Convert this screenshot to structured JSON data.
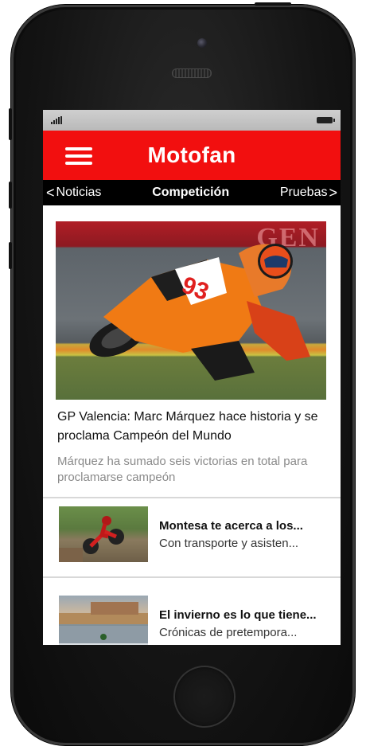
{
  "app": {
    "title": "Motofan"
  },
  "tabs": [
    {
      "label": "Noticias",
      "arrow": "<"
    },
    {
      "label": "Competición"
    },
    {
      "label": "Pruebas",
      "arrow": ">"
    }
  ],
  "hero": {
    "headline": "GP Valencia: Marc Márquez hace historia y se proclama Campeón del Mundo",
    "summary": "Márquez ha sumado seis victorias en total para proclamarse campeón",
    "banner_text": "GEN",
    "bike_number": "93"
  },
  "articles": [
    {
      "title": "Montesa te acerca a los...",
      "subtitle": "Con transporte y asisten..."
    },
    {
      "title": "El invierno es lo que tiene...",
      "subtitle": "Crónicas de pretempora..."
    }
  ],
  "colors": {
    "accent": "#f20f0f",
    "tabbar": "#000000"
  }
}
